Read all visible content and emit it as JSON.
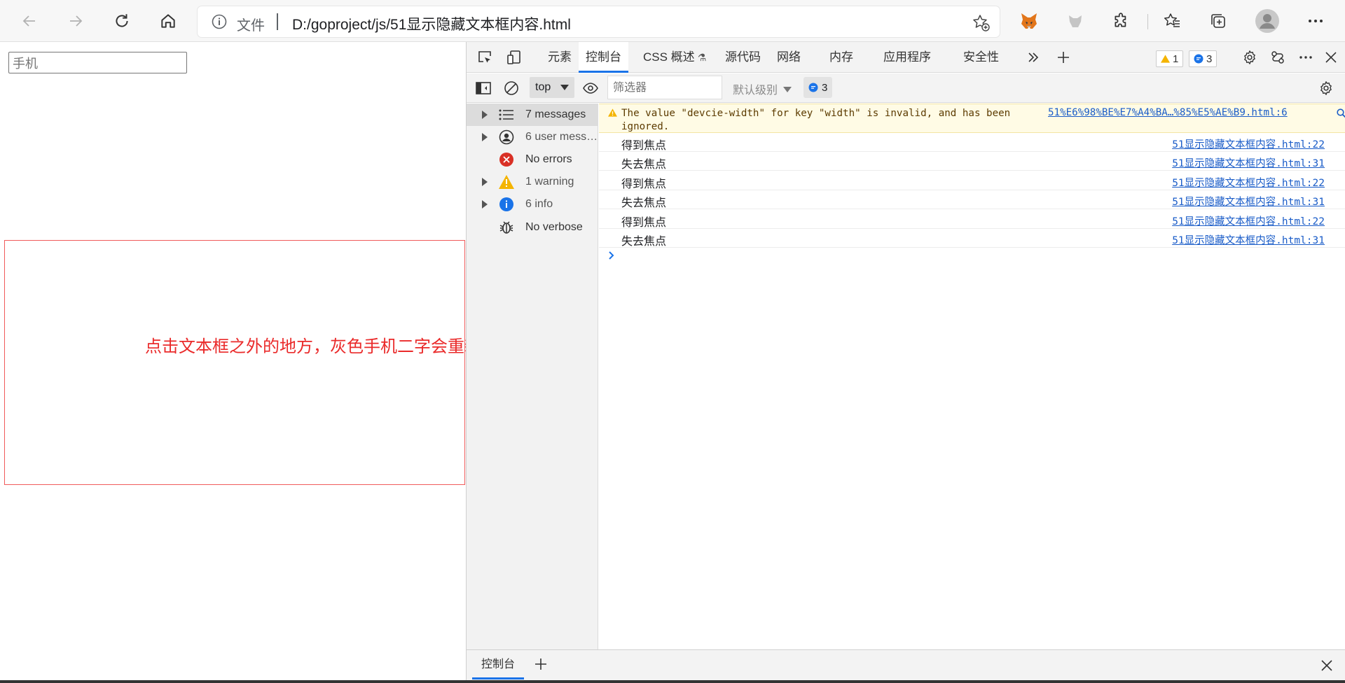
{
  "browser": {
    "address_scheme": "文件",
    "address_url": "D:/goproject/js/51显示隐藏文本框内容.html"
  },
  "page": {
    "input_placeholder": "手机",
    "box_text": "点击文本框之外的地方，灰色手机二字会重新显示"
  },
  "devtools": {
    "tabs": [
      "元素",
      "控制台",
      "CSS 概述",
      "源代码",
      "网络",
      "内存",
      "应用程序",
      "安全性"
    ],
    "active_tab": "控制台",
    "warning_count": "1",
    "message_count": "3",
    "context": "top",
    "filter_placeholder": "筛选器",
    "level_label": "默认级别",
    "filter_msg_count": "3",
    "sidebar": [
      {
        "label": "7 messages",
        "icon": "list-icon"
      },
      {
        "label": "6 user messa...",
        "icon": "user-icon"
      },
      {
        "label": "No errors",
        "icon": "error-icon"
      },
      {
        "label": "1 warning",
        "icon": "warning-icon"
      },
      {
        "label": "6 info",
        "icon": "info-icon"
      },
      {
        "label": "No verbose",
        "icon": "bug-icon"
      }
    ],
    "warning": {
      "text": "The value \"devcie-width\" for key \"width\" is invalid, and has been ignored.",
      "source": "51%E6%98%BE%E7%A4%BA…%85%E5%AE%B9.html:6"
    },
    "logs": [
      {
        "msg": "得到焦点",
        "src": "51显示隐藏文本框内容.html:22"
      },
      {
        "msg": "失去焦点",
        "src": "51显示隐藏文本框内容.html:31"
      },
      {
        "msg": "得到焦点",
        "src": "51显示隐藏文本框内容.html:22"
      },
      {
        "msg": "失去焦点",
        "src": "51显示隐藏文本框内容.html:31"
      },
      {
        "msg": "得到焦点",
        "src": "51显示隐藏文本框内容.html:22"
      },
      {
        "msg": "失去焦点",
        "src": "51显示隐藏文本框内容.html:31"
      }
    ],
    "drawer_tab": "控制台"
  },
  "colors": {
    "accent": "#1a73e8",
    "red_text": "#ea2a2a",
    "warning_bg": "#fffbe5",
    "link": "#1a5cc8"
  }
}
